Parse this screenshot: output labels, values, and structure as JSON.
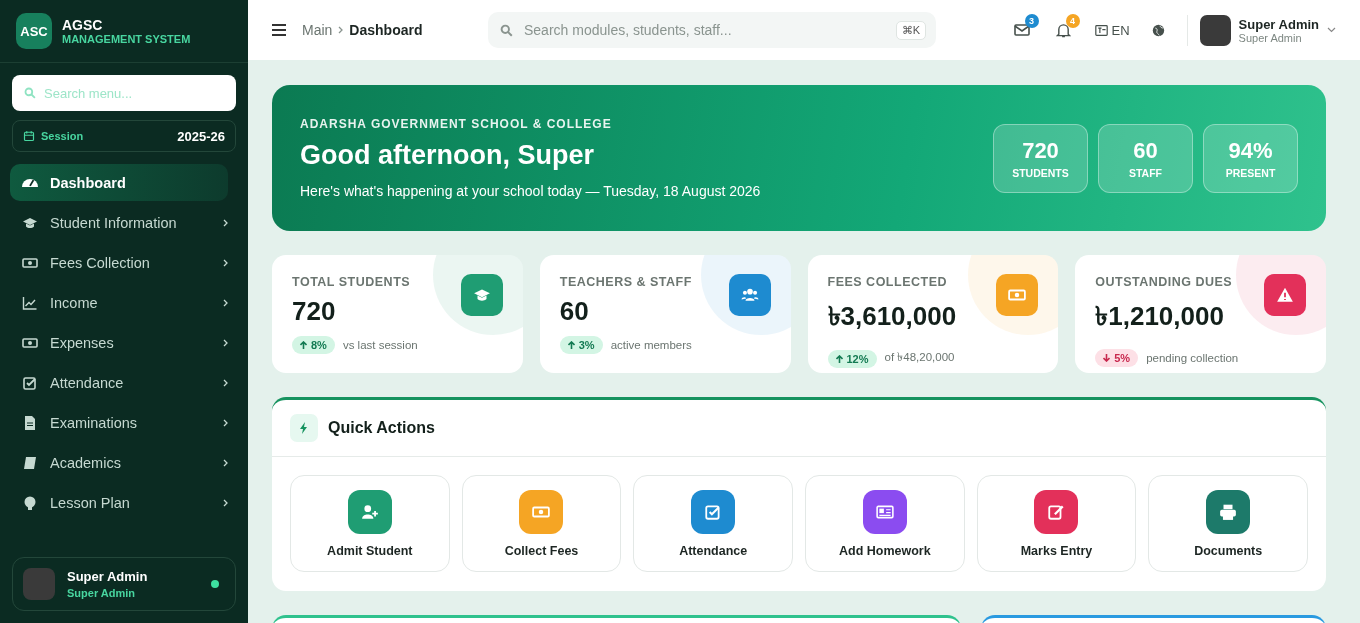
{
  "brand": {
    "logo": "ASC",
    "name": "AGSC",
    "subtitle": "MANAGEMENT SYSTEM"
  },
  "sidebar": {
    "search": {
      "placeholder": "Search menu..."
    },
    "session": {
      "label": "Session",
      "value": "2025-26"
    },
    "items": [
      {
        "label": "Dashboard",
        "selected": true,
        "has_submenu": false
      },
      {
        "label": "Student Information",
        "selected": false,
        "has_submenu": true
      },
      {
        "label": "Fees Collection",
        "selected": false,
        "has_submenu": true
      },
      {
        "label": "Income",
        "selected": false,
        "has_submenu": true
      },
      {
        "label": "Expenses",
        "selected": false,
        "has_submenu": true
      },
      {
        "label": "Attendance",
        "selected": false,
        "has_submenu": true
      },
      {
        "label": "Examinations",
        "selected": false,
        "has_submenu": true
      },
      {
        "label": "Academics",
        "selected": false,
        "has_submenu": true
      },
      {
        "label": "Lesson Plan",
        "selected": false,
        "has_submenu": true
      }
    ],
    "user": {
      "name": "Super Admin",
      "role": "Super Admin",
      "online": true
    }
  },
  "topbar": {
    "breadcrumb": [
      "Main",
      "Dashboard"
    ],
    "search": {
      "placeholder": "Search modules, students, staff...",
      "shortcut": "⌘K"
    },
    "messages_badge": "3",
    "notifications_badge": "4",
    "language": "EN",
    "user": {
      "name": "Super Admin",
      "role": "Super Admin"
    }
  },
  "hero": {
    "school": "ADARSHA GOVERNMENT SCHOOL & COLLEGE",
    "greeting": "Good afternoon, Super",
    "subtitle": "Here's what's happening at your school today — Tuesday, 18 August 2026",
    "stats": [
      {
        "value": "720",
        "label": "STUDENTS"
      },
      {
        "value": "60",
        "label": "STAFF"
      },
      {
        "value": "94%",
        "label": "PRESENT"
      }
    ]
  },
  "stat_cards": [
    {
      "title": "TOTAL STUDENTS",
      "value": "720",
      "change": "8%",
      "negative": false,
      "note": "vs last session",
      "color": "#1f9d73"
    },
    {
      "title": "TEACHERS & STAFF",
      "value": "60",
      "change": "3%",
      "negative": false,
      "note": "active members",
      "color": "#1e8bd0"
    },
    {
      "title": "FEES COLLECTED",
      "value": "৳3,610,000",
      "change": "12%",
      "negative": false,
      "note": "of ৳48,20,000",
      "color": "#f5a524"
    },
    {
      "title": "OUTSTANDING DUES",
      "value": "৳1,210,000",
      "change": "5%",
      "negative": true,
      "note": "pending collection",
      "color": "#e3305a"
    }
  ],
  "quick_actions": {
    "title": "Quick Actions",
    "items": [
      {
        "label": "Admit Student",
        "color": "#1f9d73"
      },
      {
        "label": "Collect Fees",
        "color": "#f5a524"
      },
      {
        "label": "Attendance",
        "color": "#1e8bd0"
      },
      {
        "label": "Add Homework",
        "color": "#8b4cf0"
      },
      {
        "label": "Marks Entry",
        "color": "#e3305a"
      },
      {
        "label": "Documents",
        "color": "#1d7a6a"
      }
    ]
  }
}
